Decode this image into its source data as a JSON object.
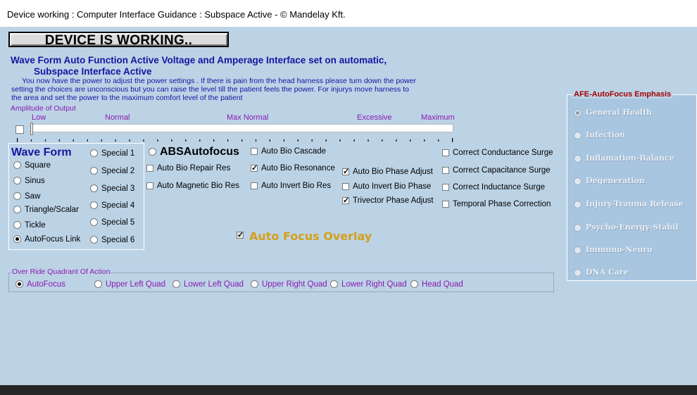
{
  "window": {
    "title": "Device working : Computer Interface Guidance : Subspace Active - © Mandelay Kft."
  },
  "status_button": "DEVICE IS WORKING..",
  "headline": {
    "line1": "Wave Form Auto Function Active  Voltage and Amperage Interface  set on automatic,",
    "line2": "Subspace Interface Active"
  },
  "instructions": [
    "You now have the power to adjust the power settings .  If there is pain from the head harness please turn down the power",
    "setting the choices are unconscious but you can raise the level till the patient feels the power. For injurys move harness to",
    "the area and set the power to the maximum comfort level of the patient"
  ],
  "amplitude": {
    "label": "Amplitude of Output",
    "scale_labels": [
      "Low",
      "Normal",
      "Max Normal",
      "Excessive",
      "Maximum"
    ],
    "value_fraction": 0.0
  },
  "waveform": {
    "title": "Wave Form",
    "options": [
      "Square",
      "Sinus",
      "Saw",
      "Triangle/Scalar",
      "Tickle",
      "AutoFocus Link"
    ],
    "selected": "AutoFocus Link",
    "specials": [
      "Special 1",
      "Special 2",
      "Special 3",
      "Special 4",
      "Special 5",
      "Special 6"
    ]
  },
  "abs_autofocus": "ABSAutofocus",
  "checks": {
    "auto_bio_cascade": {
      "label": "Auto Bio Cascade",
      "checked": false
    },
    "auto_bio_repair_res": {
      "label": "Auto Bio Repair Res",
      "checked": false
    },
    "auto_bio_resonance": {
      "label": "Auto Bio Resonance",
      "checked": true
    },
    "auto_bio_phase_adjust": {
      "label": "Auto Bio Phase Adjust",
      "checked": true
    },
    "auto_magnetic_bio_res": {
      "label": "Auto Magnetic Bio Res",
      "checked": false
    },
    "auto_invert_bio_res": {
      "label": "Auto Invert Bio Res",
      "checked": false
    },
    "auto_invert_bio_phase": {
      "label": "Auto Invert Bio Phase",
      "checked": false
    },
    "trivector_phase_adjust": {
      "label": "Trivector Phase Adjust",
      "checked": true
    },
    "correct_conductance_surge": {
      "label": "Correct Conductance Surge",
      "checked": false
    },
    "correct_capacitance_surge": {
      "label": "Correct Capacitance Surge",
      "checked": false
    },
    "correct_inductance_surge": {
      "label": "Correct  Inductance Surge",
      "checked": false
    },
    "temporal_phase_correction": {
      "label": "Temporal Phase Correction",
      "checked": false
    }
  },
  "overlay": {
    "label": "Auto Focus Overlay",
    "checked": true,
    "color": "#d4a017"
  },
  "quadrant": {
    "legend": "Over Ride Quadrant Of Action",
    "options": [
      "AutoFocus",
      "Upper Left Quad",
      "Lower Left Quad",
      "Upper Right Quad",
      "Lower Right Quad",
      "Head Quad"
    ],
    "selected": "AutoFocus"
  },
  "afe": {
    "title": "AFE-AutoFocus Emphasis",
    "options": [
      "General Health",
      "Infection",
      "Inflamation-Balance",
      "Degeneration",
      "Injury-Trauma Release",
      "Psycho-Energy-Stabil",
      "Immuno-Neuro",
      "DNA Care"
    ],
    "selected": "General Health"
  },
  "colors": {
    "background": "#bcd3e6",
    "heading_blue": "#1515a0",
    "label_purple": "#8a1ab0",
    "afe_title_red": "#a00000"
  }
}
